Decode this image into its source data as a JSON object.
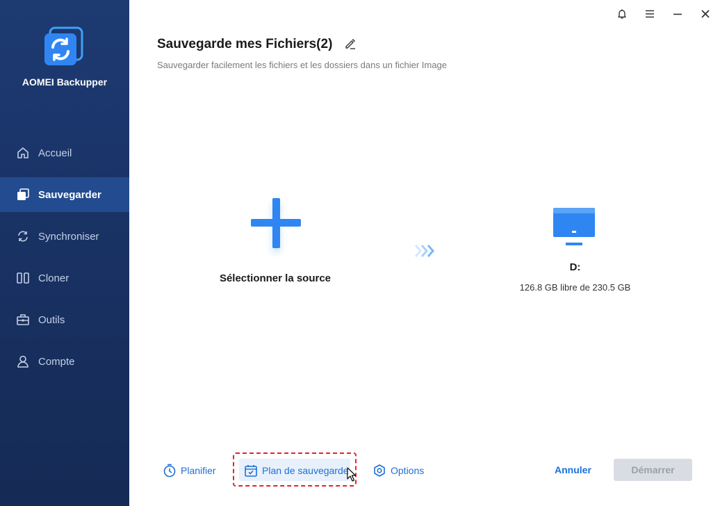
{
  "app": {
    "name": "AOMEI Backupper"
  },
  "sidebar": {
    "items": [
      {
        "label": "Accueil",
        "icon": "home-icon"
      },
      {
        "label": "Sauvegarder",
        "icon": "backup-icon",
        "active": true
      },
      {
        "label": "Synchroniser",
        "icon": "sync-icon"
      },
      {
        "label": "Cloner",
        "icon": "clone-icon"
      },
      {
        "label": "Outils",
        "icon": "tools-icon"
      },
      {
        "label": "Compte",
        "icon": "user-icon"
      }
    ]
  },
  "titlebar": {
    "icons": [
      "bell-icon",
      "menu-icon",
      "minimize-icon",
      "close-icon"
    ]
  },
  "header": {
    "title": "Sauvegarde mes Fichiers(2)",
    "subtitle": "Sauvegarder facilement les fichiers et les dossiers dans un fichier Image"
  },
  "source": {
    "label": "Sélectionner la source"
  },
  "destination": {
    "label": "D:",
    "free": "126.8 GB libre de 230.5 GB"
  },
  "toolbar": {
    "schedule_label": "Planifier",
    "plan_label": "Plan de sauvegarde",
    "options_label": "Options",
    "cancel_label": "Annuler",
    "start_label": "Démarrer"
  },
  "colors": {
    "sidebar_bg": "#1d3a72",
    "sidebar_active": "#234b8f",
    "accent": "#2f86f2",
    "link": "#1c6fd6",
    "highlight_border": "#e3242b",
    "start_disabled": "#d9dde3"
  }
}
